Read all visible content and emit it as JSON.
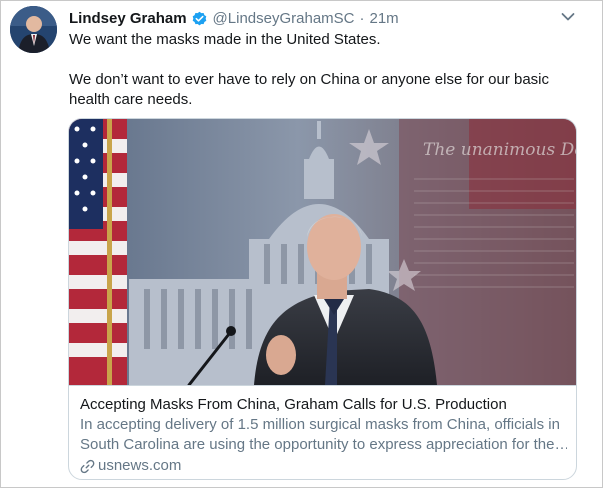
{
  "tweet": {
    "author_name": "Lindsey Graham",
    "author_handle": "@LindseyGrahamSC",
    "separator": "·",
    "timestamp": "21m",
    "text_line1": "We want the masks made in the United States.",
    "text_line2": "We don’t want to ever have to rely on China or anyone else for our basic health care needs."
  },
  "card": {
    "title": "Accepting Masks From China, Graham Calls for U.S. Production",
    "description_line1": "In accepting delivery of 1.5 million surgical masks from China, officials in",
    "description_line2": "South Carolina are using the opportunity to express appreciation for the…",
    "domain": "usnews.com",
    "image_caption_text": "The unanimous Decl"
  },
  "icons": {
    "verified": "verified-badge-icon",
    "more": "chevron-down-icon",
    "link": "link-icon"
  },
  "colors": {
    "verified_blue": "#1da1f2",
    "secondary_text": "#657786",
    "primary_text": "#14171a",
    "card_border": "#ccd6dd"
  }
}
